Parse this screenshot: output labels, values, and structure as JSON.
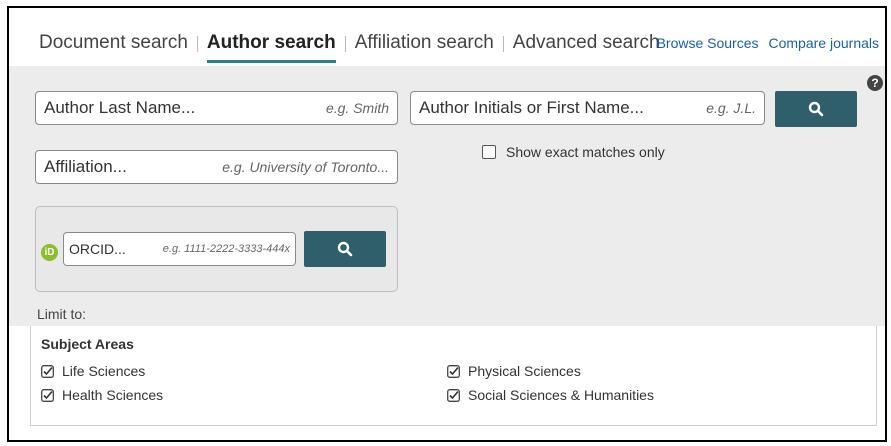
{
  "tabs": [
    {
      "label": "Document search",
      "active": false
    },
    {
      "label": "Author search",
      "active": true
    },
    {
      "label": "Affiliation search",
      "active": false
    },
    {
      "label": "Advanced search",
      "active": false
    }
  ],
  "links": {
    "browse_sources": "Browse Sources",
    "compare_journals": "Compare journals"
  },
  "help_icon": "?",
  "author_last_name": {
    "placeholder": "Author Last Name...",
    "example": "e.g. Smith"
  },
  "author_initials": {
    "placeholder": "Author Initials or First Name...",
    "example": "e.g. J.L."
  },
  "affiliation": {
    "placeholder": "Affiliation...",
    "example": "e.g. University of Toronto..."
  },
  "exact_matches": {
    "label": "Show exact matches only",
    "checked": false
  },
  "orcid": {
    "logo": "iD",
    "placeholder": "ORCID...",
    "example": "e.g. 1111-2222-3333-444x"
  },
  "limit_to": "Limit to:",
  "subject_areas": {
    "title": "Subject Areas",
    "items": [
      {
        "label": "Life Sciences",
        "checked": true
      },
      {
        "label": "Health Sciences",
        "checked": true
      },
      {
        "label": "Physical Sciences",
        "checked": true
      },
      {
        "label": "Social Sciences & Humanities",
        "checked": true
      }
    ]
  },
  "colors": {
    "accent": "#2e7d8c",
    "button": "#2f5f6b",
    "link": "#1a5fa8",
    "panel": "#ececec",
    "orcid": "#8bbd2c"
  },
  "icons": {
    "search": "search-icon",
    "checkbox": "checkbox-checked-icon",
    "help": "help-icon",
    "orcid": "orcid-icon"
  }
}
